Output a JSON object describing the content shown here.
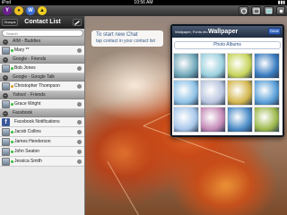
{
  "status_bar": {
    "carrier": "iPod",
    "time": "10:56 AM",
    "battery": "▮▮▮"
  },
  "toolbar": {
    "icons": [
      "yahoo-icon",
      "voice-icon",
      "messenger-icon",
      "aim-icon"
    ],
    "right_icons": [
      "settings-icon",
      "status-icon",
      "wallpaper-icon",
      "gear-icon"
    ]
  },
  "contact_list": {
    "title": "Contact List",
    "groups_label": "Groups",
    "search_placeholder": "Search",
    "sections": [
      {
        "header": "AIM - Buddies",
        "contacts": [
          {
            "name": "Mary **",
            "status": "#3cbe3c"
          }
        ]
      },
      {
        "header": "Google - Friends",
        "contacts": [
          {
            "name": "Bob Jones",
            "status": "#3cbe3c"
          }
        ]
      },
      {
        "header": "Google - Google Talk",
        "contacts": [
          {
            "name": "Christopher Thompson",
            "status": "#d8a028"
          }
        ]
      },
      {
        "header": "Yahoo! - Friends",
        "contacts": [
          {
            "name": "Grace Wright",
            "status": "#3cbe3c"
          }
        ]
      },
      {
        "header": "Facebook",
        "contacts": [
          {
            "name": "Facebook Notifications",
            "status": "",
            "fb": true
          },
          {
            "name": "Jacob Collins",
            "status": "#3cbe3c"
          },
          {
            "name": "James Henderson",
            "status": "#3cbe3c"
          },
          {
            "name": "John Seaton",
            "status": "#3cbe3c"
          },
          {
            "name": "Jessica Smith",
            "status": "#3cbe3c"
          }
        ]
      }
    ]
  },
  "new_chat": {
    "line1": "To start new Chat",
    "line2": "tap contact in your contact list"
  },
  "wallpaper": {
    "crumb": "Wallpaper, Fonts etc.",
    "title": "Wallpaper",
    "done": "Done",
    "albums_button": "Photo Albums",
    "thumbs": [
      "#6fa7b9",
      "#9ad0de",
      "#c7d45a",
      "#3a7cc0",
      "#8fc2e6",
      "#b8c4de",
      "#d3b64c",
      "#5a9fd8",
      "#a7c7ea",
      "#c48ab7",
      "#4b8cc7",
      "#9db94c"
    ]
  }
}
